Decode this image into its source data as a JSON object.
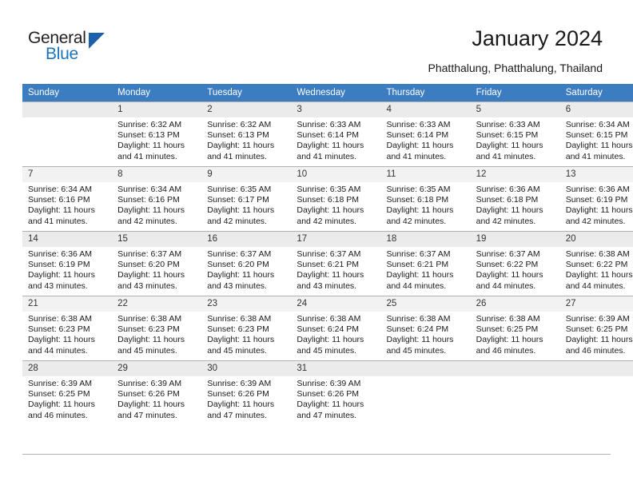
{
  "brand": {
    "name_part1": "General",
    "name_part2": "Blue",
    "accent_color": "#1b75bb",
    "triangle_color": "#1b61ac"
  },
  "header": {
    "title": "January 2024",
    "subtitle": "Phatthalung, Phatthalung, Thailand"
  },
  "calendar": {
    "header_background": "#3b7dc0",
    "weekday_headers": [
      "Sunday",
      "Monday",
      "Tuesday",
      "Wednesday",
      "Thursday",
      "Friday",
      "Saturday"
    ],
    "labels": {
      "sunrise": "Sunrise:",
      "sunset": "Sunset:",
      "daylight": "Daylight:"
    },
    "weeks": [
      [
        {
          "day": "",
          "sunrise": "",
          "sunset": "",
          "daylight": ""
        },
        {
          "day": "1",
          "sunrise": "Sunrise: 6:32 AM",
          "sunset": "Sunset: 6:13 PM",
          "daylight": "Daylight: 11 hours and 41 minutes."
        },
        {
          "day": "2",
          "sunrise": "Sunrise: 6:32 AM",
          "sunset": "Sunset: 6:13 PM",
          "daylight": "Daylight: 11 hours and 41 minutes."
        },
        {
          "day": "3",
          "sunrise": "Sunrise: 6:33 AM",
          "sunset": "Sunset: 6:14 PM",
          "daylight": "Daylight: 11 hours and 41 minutes."
        },
        {
          "day": "4",
          "sunrise": "Sunrise: 6:33 AM",
          "sunset": "Sunset: 6:14 PM",
          "daylight": "Daylight: 11 hours and 41 minutes."
        },
        {
          "day": "5",
          "sunrise": "Sunrise: 6:33 AM",
          "sunset": "Sunset: 6:15 PM",
          "daylight": "Daylight: 11 hours and 41 minutes."
        },
        {
          "day": "6",
          "sunrise": "Sunrise: 6:34 AM",
          "sunset": "Sunset: 6:15 PM",
          "daylight": "Daylight: 11 hours and 41 minutes."
        }
      ],
      [
        {
          "day": "7",
          "sunrise": "Sunrise: 6:34 AM",
          "sunset": "Sunset: 6:16 PM",
          "daylight": "Daylight: 11 hours and 41 minutes."
        },
        {
          "day": "8",
          "sunrise": "Sunrise: 6:34 AM",
          "sunset": "Sunset: 6:16 PM",
          "daylight": "Daylight: 11 hours and 42 minutes."
        },
        {
          "day": "9",
          "sunrise": "Sunrise: 6:35 AM",
          "sunset": "Sunset: 6:17 PM",
          "daylight": "Daylight: 11 hours and 42 minutes."
        },
        {
          "day": "10",
          "sunrise": "Sunrise: 6:35 AM",
          "sunset": "Sunset: 6:18 PM",
          "daylight": "Daylight: 11 hours and 42 minutes."
        },
        {
          "day": "11",
          "sunrise": "Sunrise: 6:35 AM",
          "sunset": "Sunset: 6:18 PM",
          "daylight": "Daylight: 11 hours and 42 minutes."
        },
        {
          "day": "12",
          "sunrise": "Sunrise: 6:36 AM",
          "sunset": "Sunset: 6:18 PM",
          "daylight": "Daylight: 11 hours and 42 minutes."
        },
        {
          "day": "13",
          "sunrise": "Sunrise: 6:36 AM",
          "sunset": "Sunset: 6:19 PM",
          "daylight": "Daylight: 11 hours and 42 minutes."
        }
      ],
      [
        {
          "day": "14",
          "sunrise": "Sunrise: 6:36 AM",
          "sunset": "Sunset: 6:19 PM",
          "daylight": "Daylight: 11 hours and 43 minutes."
        },
        {
          "day": "15",
          "sunrise": "Sunrise: 6:37 AM",
          "sunset": "Sunset: 6:20 PM",
          "daylight": "Daylight: 11 hours and 43 minutes."
        },
        {
          "day": "16",
          "sunrise": "Sunrise: 6:37 AM",
          "sunset": "Sunset: 6:20 PM",
          "daylight": "Daylight: 11 hours and 43 minutes."
        },
        {
          "day": "17",
          "sunrise": "Sunrise: 6:37 AM",
          "sunset": "Sunset: 6:21 PM",
          "daylight": "Daylight: 11 hours and 43 minutes."
        },
        {
          "day": "18",
          "sunrise": "Sunrise: 6:37 AM",
          "sunset": "Sunset: 6:21 PM",
          "daylight": "Daylight: 11 hours and 44 minutes."
        },
        {
          "day": "19",
          "sunrise": "Sunrise: 6:37 AM",
          "sunset": "Sunset: 6:22 PM",
          "daylight": "Daylight: 11 hours and 44 minutes."
        },
        {
          "day": "20",
          "sunrise": "Sunrise: 6:38 AM",
          "sunset": "Sunset: 6:22 PM",
          "daylight": "Daylight: 11 hours and 44 minutes."
        }
      ],
      [
        {
          "day": "21",
          "sunrise": "Sunrise: 6:38 AM",
          "sunset": "Sunset: 6:23 PM",
          "daylight": "Daylight: 11 hours and 44 minutes."
        },
        {
          "day": "22",
          "sunrise": "Sunrise: 6:38 AM",
          "sunset": "Sunset: 6:23 PM",
          "daylight": "Daylight: 11 hours and 45 minutes."
        },
        {
          "day": "23",
          "sunrise": "Sunrise: 6:38 AM",
          "sunset": "Sunset: 6:23 PM",
          "daylight": "Daylight: 11 hours and 45 minutes."
        },
        {
          "day": "24",
          "sunrise": "Sunrise: 6:38 AM",
          "sunset": "Sunset: 6:24 PM",
          "daylight": "Daylight: 11 hours and 45 minutes."
        },
        {
          "day": "25",
          "sunrise": "Sunrise: 6:38 AM",
          "sunset": "Sunset: 6:24 PM",
          "daylight": "Daylight: 11 hours and 45 minutes."
        },
        {
          "day": "26",
          "sunrise": "Sunrise: 6:38 AM",
          "sunset": "Sunset: 6:25 PM",
          "daylight": "Daylight: 11 hours and 46 minutes."
        },
        {
          "day": "27",
          "sunrise": "Sunrise: 6:39 AM",
          "sunset": "Sunset: 6:25 PM",
          "daylight": "Daylight: 11 hours and 46 minutes."
        }
      ],
      [
        {
          "day": "28",
          "sunrise": "Sunrise: 6:39 AM",
          "sunset": "Sunset: 6:25 PM",
          "daylight": "Daylight: 11 hours and 46 minutes."
        },
        {
          "day": "29",
          "sunrise": "Sunrise: 6:39 AM",
          "sunset": "Sunset: 6:26 PM",
          "daylight": "Daylight: 11 hours and 47 minutes."
        },
        {
          "day": "30",
          "sunrise": "Sunrise: 6:39 AM",
          "sunset": "Sunset: 6:26 PM",
          "daylight": "Daylight: 11 hours and 47 minutes."
        },
        {
          "day": "31",
          "sunrise": "Sunrise: 6:39 AM",
          "sunset": "Sunset: 6:26 PM",
          "daylight": "Daylight: 11 hours and 47 minutes."
        },
        {
          "day": "",
          "sunrise": "",
          "sunset": "",
          "daylight": ""
        },
        {
          "day": "",
          "sunrise": "",
          "sunset": "",
          "daylight": ""
        },
        {
          "day": "",
          "sunrise": "",
          "sunset": "",
          "daylight": ""
        }
      ]
    ]
  }
}
